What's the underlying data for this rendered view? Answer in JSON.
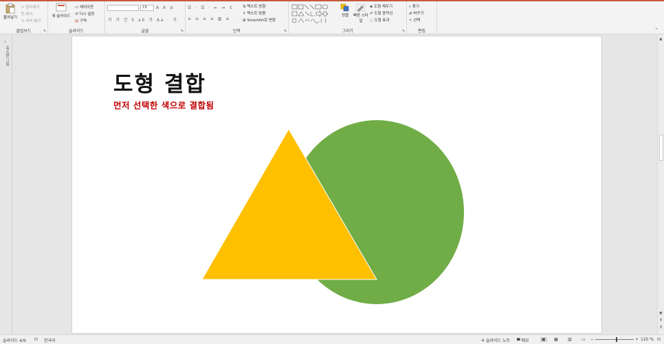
{
  "ribbon": {
    "clipboard": {
      "paste": "붙여넣기",
      "cut": "잘라내기",
      "copy": "복사",
      "format_painter": "서식 복사",
      "title": "클립보드"
    },
    "slides": {
      "new_slide": "새 슬라이드",
      "layout": "레이아웃",
      "reset": "다시 설정",
      "section": "구역",
      "title": "슬라이드"
    },
    "font": {
      "size": "18",
      "title": "글꼴"
    },
    "paragraph": {
      "text_direction": "텍스트 방향",
      "align_text": "텍스트 맞춤",
      "smartart": "SmartArt로 변환",
      "title": "단락"
    },
    "drawing": {
      "arrange": "정렬",
      "quick_styles": "빠른 스타일",
      "shape_fill": "도형 채우기",
      "shape_outline": "도형 윤곽선",
      "shape_effects": "도형 효과",
      "title": "그리기"
    },
    "editing": {
      "find": "찾기",
      "replace": "바꾸기",
      "select": "선택",
      "title": "편집"
    }
  },
  "rail": {
    "label": "축소판 그림"
  },
  "slide": {
    "title": "도형 결합",
    "subtitle": "먼저 선택한 색으로 결합됨",
    "shapes": [
      {
        "kind": "circle",
        "name": "green-circle",
        "color": "#70ad47"
      },
      {
        "kind": "triangle",
        "name": "yellow-triangle",
        "color": "#ffc000"
      }
    ]
  },
  "status": {
    "slide_info": "슬라이드 4/9",
    "language": "한국어",
    "notes": "슬라이드 노트",
    "comments": "메모",
    "zoom": "120 %"
  }
}
